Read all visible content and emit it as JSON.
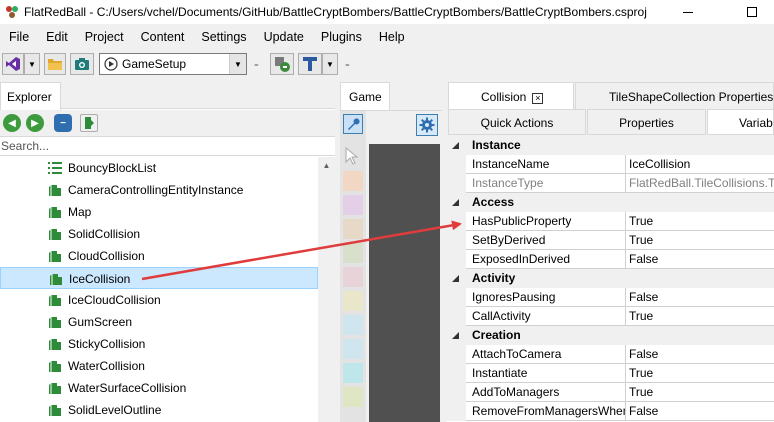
{
  "window": {
    "title": "FlatRedBall - C:/Users/vchel/Documents/GitHub/BattleCryptBombers/BattleCryptBombers/BattleCryptBombers.csproj"
  },
  "menu": [
    "File",
    "Edit",
    "Project",
    "Content",
    "Settings",
    "Update",
    "Plugins",
    "Help"
  ],
  "toolbar": {
    "screen_combo_value": "GameSetup"
  },
  "explorer": {
    "tab_label": "Explorer",
    "search_placeholder": "Search...",
    "items": [
      {
        "label": "BouncyBlockList",
        "kind": "list"
      },
      {
        "label": "CameraControllingEntityInstance",
        "kind": "object"
      },
      {
        "label": "Map",
        "kind": "object"
      },
      {
        "label": "SolidCollision",
        "kind": "object"
      },
      {
        "label": "CloudCollision",
        "kind": "object"
      },
      {
        "label": "IceCollision",
        "kind": "object",
        "selected": true
      },
      {
        "label": "IceCloudCollision",
        "kind": "object"
      },
      {
        "label": "GumScreen",
        "kind": "object"
      },
      {
        "label": "StickyCollision",
        "kind": "object"
      },
      {
        "label": "WaterCollision",
        "kind": "object"
      },
      {
        "label": "WaterSurfaceCollision",
        "kind": "object"
      },
      {
        "label": "SolidLevelOutline",
        "kind": "object"
      }
    ]
  },
  "game": {
    "tab_label": "Game"
  },
  "right_tabs": {
    "top": [
      {
        "label": "Collision",
        "active": true
      },
      {
        "label": "TileShapeCollection Properties",
        "active": false
      }
    ],
    "second": [
      {
        "label": "Quick Actions",
        "active": false
      },
      {
        "label": "Properties",
        "active": false
      },
      {
        "label": "Variables",
        "active": true
      }
    ]
  },
  "property_grid": {
    "categories": [
      {
        "label": "Instance",
        "rows": [
          {
            "name": "InstanceName",
            "value": "IceCollision",
            "dim": false
          },
          {
            "name": "InstanceType",
            "value": "FlatRedBall.TileCollisions.TileShapeCollection",
            "dim": true
          }
        ]
      },
      {
        "label": "Access",
        "rows": [
          {
            "name": "HasPublicProperty",
            "value": "True",
            "dim": false
          },
          {
            "name": "SetByDerived",
            "value": "True",
            "dim": false
          },
          {
            "name": "ExposedInDerived",
            "value": "False",
            "dim": false
          }
        ]
      },
      {
        "label": "Activity",
        "rows": [
          {
            "name": "IgnoresPausing",
            "value": "False",
            "dim": false
          },
          {
            "name": "CallActivity",
            "value": "True",
            "dim": false
          }
        ]
      },
      {
        "label": "Creation",
        "rows": [
          {
            "name": "AttachToCamera",
            "value": "False",
            "dim": false
          },
          {
            "name": "Instantiate",
            "value": "True",
            "dim": false
          },
          {
            "name": "AddToManagers",
            "value": "True",
            "dim": false
          },
          {
            "name": "RemoveFromManagersWhenInvisible",
            "value": "False",
            "dim": false
          }
        ]
      }
    ]
  },
  "colors": {
    "annotation_arrow": "#e03c3c",
    "selection_fill": "#cce8ff",
    "entity_icon": "#2e8b3a"
  }
}
